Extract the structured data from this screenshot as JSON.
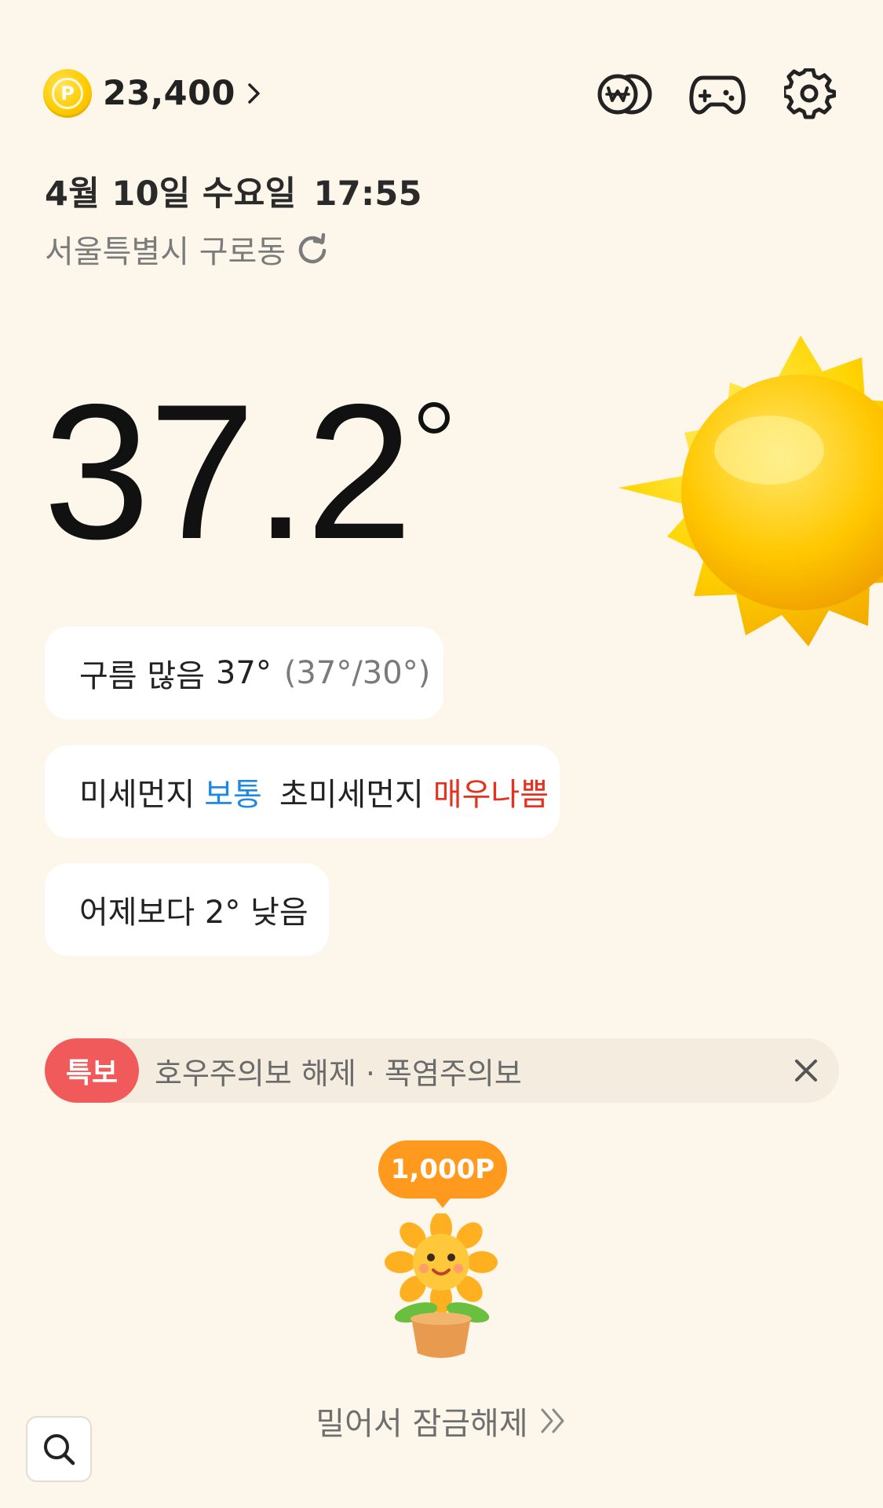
{
  "header": {
    "points_value": "23,400",
    "icons": [
      "coin-p-icon",
      "chevron-right-icon",
      "won-exchange-icon",
      "gamepad-icon",
      "gear-icon"
    ]
  },
  "info": {
    "date": "4월 10일 수요일",
    "time": "17:55",
    "location": "서울특별시 구로동"
  },
  "weather": {
    "temperature": "37.2",
    "condition_label": "구름 많음",
    "current_temp": "37°",
    "range": "(37°/30°)",
    "dust_label": "미세먼지",
    "dust_value": "보통",
    "fine_dust_label": "초미세먼지",
    "fine_dust_value": "매우나쁨",
    "yesterday_compare": "어제보다 2° 낮음"
  },
  "alert": {
    "badge": "특보",
    "text": "호우주의보 해제 · 폭염주의보"
  },
  "reward": {
    "points": "1,000P"
  },
  "unlock": {
    "label": "밀어서 잠금해제"
  },
  "colors": {
    "background": "#fdf6ea",
    "good": "#1e88e5",
    "bad": "#e5311e",
    "alert_badge": "#f15a5a",
    "reward": "#ff9a1f"
  }
}
